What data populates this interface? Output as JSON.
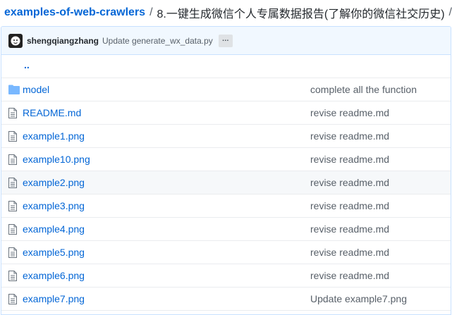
{
  "breadcrumb": {
    "repo": "examples-of-web-crawlers",
    "separator": "/",
    "path": "8.一键生成微信个人专属数据报告(了解你的微信社交历史)",
    "trailing_separator": "/"
  },
  "commit": {
    "author": "shengqiangzhang",
    "message": "Update generate_wx_data.py",
    "ellipsis": "…"
  },
  "updir": "..",
  "files": [
    {
      "type": "folder",
      "name": "model",
      "message": "complete all the function"
    },
    {
      "type": "file",
      "name": "README.md",
      "message": "revise readme.md"
    },
    {
      "type": "file",
      "name": "example1.png",
      "message": "revise readme.md"
    },
    {
      "type": "file",
      "name": "example10.png",
      "message": "revise readme.md"
    },
    {
      "type": "file",
      "name": "example2.png",
      "message": "revise readme.md"
    },
    {
      "type": "file",
      "name": "example3.png",
      "message": "revise readme.md"
    },
    {
      "type": "file",
      "name": "example4.png",
      "message": "revise readme.md"
    },
    {
      "type": "file",
      "name": "example5.png",
      "message": "revise readme.md"
    },
    {
      "type": "file",
      "name": "example6.png",
      "message": "revise readme.md"
    },
    {
      "type": "file",
      "name": "example7.png",
      "message": "Update example7.png"
    }
  ],
  "colors": {
    "link": "#0366d6",
    "commit_bar_bg": "#f1f8ff",
    "folder_icon": "#79b8ff",
    "file_icon": "#6a737d",
    "hover_row_bg": "#f6f8fa"
  },
  "icons": {
    "folder": "folder-icon",
    "file": "file-icon",
    "avatar": "avatar-icon"
  }
}
